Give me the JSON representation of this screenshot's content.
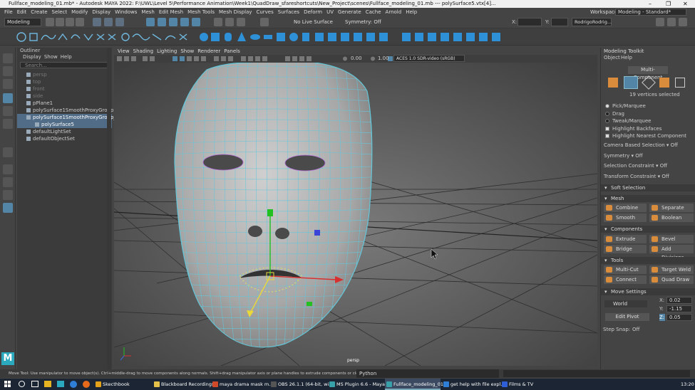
{
  "window": {
    "title": "Fullface_modeling_01.mb* - Autodesk MAYA 2022: F:\\UWL\\Level 5\\Performance Animation\\Week1\\QuadDraw_sfareshortcuts\\New_Project\\scenes\\Fullface_modeling_01.mb  ---  polySurface5.vtx[4]..."
  },
  "menubar": [
    "File",
    "Edit",
    "Create",
    "Select",
    "Modify",
    "Display",
    "Windows",
    "Mesh",
    "Edit Mesh",
    "Mesh Tools",
    "Mesh Display",
    "Curves",
    "Surfaces",
    "Deform",
    "UV",
    "Generate",
    "Cache",
    "Arnold",
    "Help"
  ],
  "workspace": {
    "label": "Workspace :",
    "value": "Modeling - Standard*"
  },
  "statusline": {
    "mode": "Modeling",
    "live": "No Live Surface",
    "symmetry": "Symmetry: Off",
    "x": "X:",
    "y": "Y:",
    "z": "Z:",
    "user": "RodrigoRodrig..."
  },
  "outliner": {
    "title": "Outliner",
    "menu": [
      "Display",
      "Show",
      "Help"
    ],
    "search": "Search...",
    "items": [
      {
        "label": "persp",
        "dim": true,
        "indent": 0
      },
      {
        "label": "top",
        "dim": true,
        "indent": 0
      },
      {
        "label": "front",
        "dim": true,
        "indent": 0
      },
      {
        "label": "side",
        "dim": true,
        "indent": 0
      },
      {
        "label": "pPlane1",
        "dim": false,
        "indent": 0
      },
      {
        "label": "polySurface1SmoothProxyGroup",
        "dim": false,
        "indent": 0
      },
      {
        "label": "polySurface1SmoothProxyGroup_pol",
        "dim": false,
        "indent": 0,
        "sel": true
      },
      {
        "label": "polySurface5",
        "dim": false,
        "indent": 1,
        "sel": true
      },
      {
        "label": "defaultLightSet",
        "dim": false,
        "indent": 0
      },
      {
        "label": "defaultObjectSet",
        "dim": false,
        "indent": 0
      }
    ]
  },
  "viewport": {
    "menu": [
      "View",
      "Shading",
      "Lighting",
      "Show",
      "Renderer",
      "Panels"
    ],
    "exposure": "0.00",
    "gamma": "1.00",
    "colorspace": "ACES 1.0 SDR-video (sRGB)",
    "camera": "persp"
  },
  "toolkit": {
    "title": "Modeling Toolkit",
    "menu": [
      "Object",
      "Help"
    ],
    "mode": "Multi-Component",
    "selected": "19 vertices selected",
    "options": [
      {
        "label": "Pick/Marquee",
        "type": "radio",
        "on": true
      },
      {
        "label": "Drag",
        "type": "radio",
        "on": false
      },
      {
        "label": "Tweak/Marquee",
        "type": "radio",
        "on": false
      },
      {
        "label": "Highlight Backfaces",
        "type": "check",
        "on": true
      },
      {
        "label": "Highlight Nearest Component",
        "type": "check",
        "on": true
      }
    ],
    "settings": [
      {
        "label": "Camera Based Selection",
        "value": "Off"
      },
      {
        "label": "Symmetry",
        "value": "Off"
      },
      {
        "label": "Selection Constraint",
        "value": "Off"
      },
      {
        "label": "Transform Constraint",
        "value": "Off"
      }
    ],
    "soft_selection": "Soft Selection",
    "mesh": {
      "title": "Mesh",
      "buttons": [
        "Combine",
        "Separate",
        "Smooth",
        "Boolean"
      ]
    },
    "components": {
      "title": "Components",
      "buttons": [
        "Extrude",
        "Bevel",
        "Bridge",
        "Add Divisions"
      ]
    },
    "tools": {
      "title": "Tools",
      "buttons": [
        "Multi-Cut",
        "Target Weld",
        "Connect",
        "Quad Draw"
      ]
    },
    "move": {
      "title": "Move Settings",
      "space": "World",
      "x_label": "X:",
      "x": "0.02",
      "y_label": "Y:",
      "y": "-1.15",
      "z_label": "Z:",
      "z": "0.05",
      "edit_pivot": "Edit Pivot",
      "step_label": "Step Snap:",
      "step": "Off"
    }
  },
  "helpline": {
    "text": "Move Tool: Use manipulator to move object(s). Ctrl+middle-drag to move components along normals. Shift+drag manipulator axis or plane handles to extrude components or clone objects. Ctrl+Shift+drag to constra",
    "tab": "Python"
  },
  "taskbar": {
    "items": [
      {
        "label": "Skecthbook",
        "color": "#e3a21a"
      },
      {
        "label": "Blackboard Recordings",
        "color": "#e6c14a"
      },
      {
        "label": "maya drama mask m...",
        "color": "#d04a2a"
      },
      {
        "label": "OBS 26.1.1 (64-bit, wi...",
        "color": "#555555"
      },
      {
        "label": "MS Plugin 6.6 - Maya",
        "color": "#38a0a8"
      },
      {
        "label": "Fullface_modeling_01...",
        "color": "#38a0a8",
        "active": true
      },
      {
        "label": "get help with file expl...",
        "color": "#2f7fd8"
      },
      {
        "label": "Films & TV",
        "color": "#2f5fd8"
      }
    ],
    "time": "13:20"
  },
  "colors": {
    "accent": "#5285a6",
    "wire": "#63c7d9",
    "orange": "#d98c3b"
  }
}
